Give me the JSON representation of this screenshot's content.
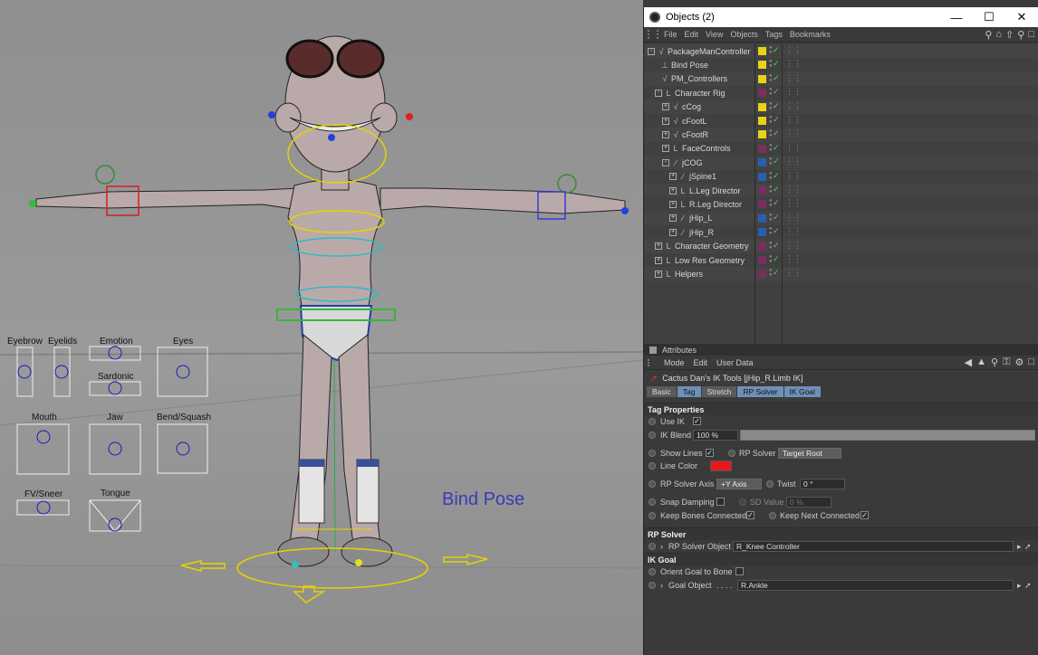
{
  "viewport": {
    "bind_pose_label": "Bind Pose",
    "face_controls": [
      {
        "label": "Eyebrow"
      },
      {
        "label": "Eyelids"
      },
      {
        "label": "Emotion"
      },
      {
        "label": "Eyes"
      },
      {
        "label": "Sardonic"
      },
      {
        "label": "Mouth"
      },
      {
        "label": "Jaw"
      },
      {
        "label": "Bend/Squash"
      },
      {
        "label": "FV/Sneer"
      },
      {
        "label": "Tongue"
      }
    ]
  },
  "objects": {
    "title": "Objects (2)",
    "menu": [
      "File",
      "Edit",
      "View",
      "Objects",
      "Tags",
      "Bookmarks"
    ],
    "rows": [
      {
        "name": "PackageManController",
        "color": "#e8d21a"
      },
      {
        "name": "Bind Pose",
        "color": "#e8d21a"
      },
      {
        "name": "PM_Controllers",
        "color": "#e8d21a"
      },
      {
        "name": "Character Rig",
        "color": "#7a2e5c"
      },
      {
        "name": "cCog",
        "color": "#e8d21a"
      },
      {
        "name": "cFootL",
        "color": "#e8d21a"
      },
      {
        "name": "cFootR",
        "color": "#e8d21a"
      },
      {
        "name": "FaceControls",
        "color": "#7a2e5c"
      },
      {
        "name": "jCOG",
        "color": "#2a5fb0"
      },
      {
        "name": "jSpine1",
        "color": "#2a5fb0"
      },
      {
        "name": "L.Leg Director",
        "color": "#7a2e5c"
      },
      {
        "name": "R.Leg Director",
        "color": "#7a2e5c"
      },
      {
        "name": "jHip_L",
        "color": "#2a5fb0"
      },
      {
        "name": "jHip_R",
        "color": "#2a5fb0"
      },
      {
        "name": "Character Geometry",
        "color": "#7a2e5c"
      },
      {
        "name": "Low Res Geometry",
        "color": "#7a2e5c"
      },
      {
        "name": "Helpers",
        "color": "#7a2e5c"
      }
    ]
  },
  "attributes": {
    "title": "Attributes",
    "menu": [
      "Mode",
      "Edit",
      "User Data"
    ],
    "header": "Cactus Dan's IK Tools  [jHip_R.Limb IK]",
    "tabs": [
      "Basic",
      "Tag",
      "Stretch",
      "RP Solver",
      "IK Goal"
    ],
    "tag_properties": "Tag Properties",
    "use_ik": "Use IK",
    "ik_blend": "IK Blend",
    "ik_blend_value": "100 %",
    "show_lines": "Show Lines",
    "rp_solver": "RP Solver",
    "target_root": "Target Root",
    "line_color": "Line Color",
    "line_color_value": "#e8181a",
    "rp_solver_axis": "RP Solver Axis",
    "rp_solver_axis_value": "+Y Axis",
    "twist": "Twist",
    "twist_value": "0 °",
    "snap_damping": "Snap Damping",
    "sd_value": "SD Value",
    "sd_value_value": "0 %",
    "keep_bones_connected": "Keep Bones Connected",
    "keep_next_connected": "Keep Next Connected",
    "rp_solver_section": "RP Solver",
    "rp_solver_object": "RP Solver Object",
    "rp_solver_object_value": "R_Knee Controller",
    "ik_goal_section": "IK Goal",
    "orient_goal_to_bone": "Orient Goal to Bone",
    "goal_object": "Goal Object",
    "goal_object_dots": ". . . .",
    "goal_object_value": "R.Ankle"
  }
}
